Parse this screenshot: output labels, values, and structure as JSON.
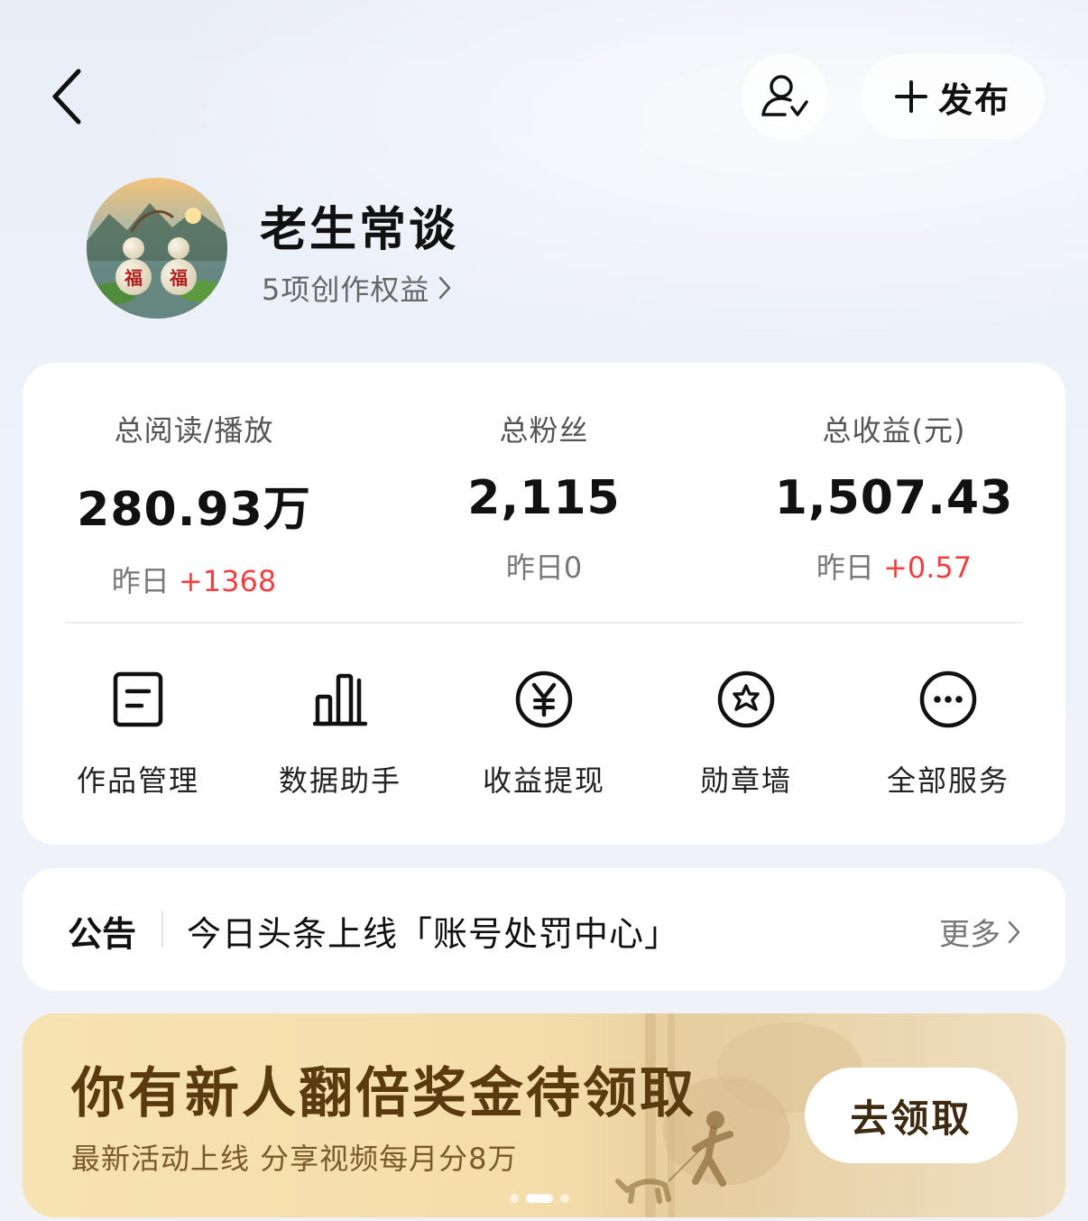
{
  "topbar": {
    "publish_label": "发布"
  },
  "profile": {
    "name": "老生常谈",
    "rights_link": "5项创作权益",
    "avatar_text": [
      "福",
      "福"
    ]
  },
  "stats": [
    {
      "label": "总阅读/播放",
      "value": "280.93万",
      "yesterday_prefix": "昨日",
      "yesterday_delta": "+1368"
    },
    {
      "label": "总粉丝",
      "value": "2,115",
      "yesterday_prefix": "昨日",
      "yesterday_delta": "0"
    },
    {
      "label": "总收益(元)",
      "value": "1,507.43",
      "yesterday_prefix": "昨日",
      "yesterday_delta": "+0.57"
    }
  ],
  "services": [
    {
      "label": "作品管理",
      "icon": "document-icon"
    },
    {
      "label": "数据助手",
      "icon": "bar-chart-icon"
    },
    {
      "label": "收益提现",
      "icon": "yen-icon"
    },
    {
      "label": "勋章墙",
      "icon": "badge-icon"
    },
    {
      "label": "全部服务",
      "icon": "more-icon"
    }
  ],
  "notice": {
    "tag": "公告",
    "text": "今日头条上线「账号处罚中心」",
    "more": "更多"
  },
  "banner": {
    "title": "你有新人翻倍奖金待领取",
    "subtitle": "最新活动上线 分享视频每月分8万",
    "cta": "去领取",
    "page_count": 3,
    "active_page": 2
  },
  "colors": {
    "delta_positive": "#f04142",
    "banner_title": "#5a3a0f",
    "card_bg": "#ffffff"
  }
}
